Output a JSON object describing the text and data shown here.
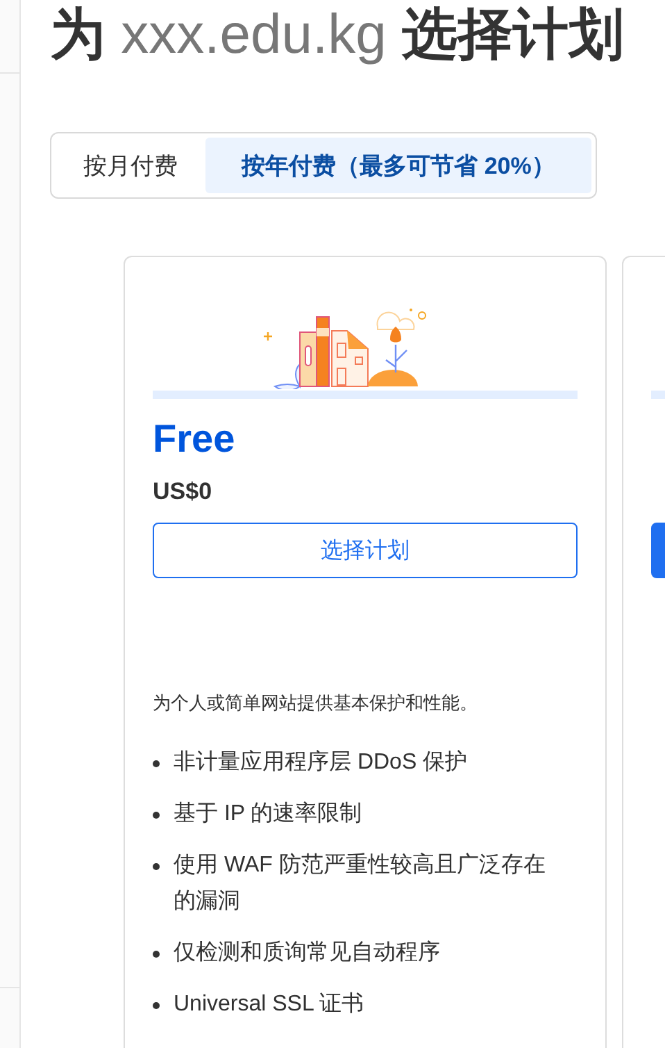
{
  "title": {
    "prefix": "为",
    "domain": "xxx.edu.kg",
    "suffix": "选择计划"
  },
  "billing_tabs": [
    {
      "label": "按月付费",
      "selected": false
    },
    {
      "label": "按年付费（最多可节省 20%）",
      "selected": true
    }
  ],
  "plans": [
    {
      "name": "Free",
      "price": "US$0",
      "button": "选择计划",
      "kind": "outline",
      "description": "为个人或简单网站提供基本保护和性能。",
      "features": [
        "非计量应用程序层 DDoS 保护",
        "基于 IP 的速率限制",
        "使用 WAF 防范严重性较高且广泛存在的漏洞",
        "仅检测和质询常见自动程序",
        "Universal SSL 证书"
      ]
    },
    {
      "kind": "filled"
    }
  ]
}
